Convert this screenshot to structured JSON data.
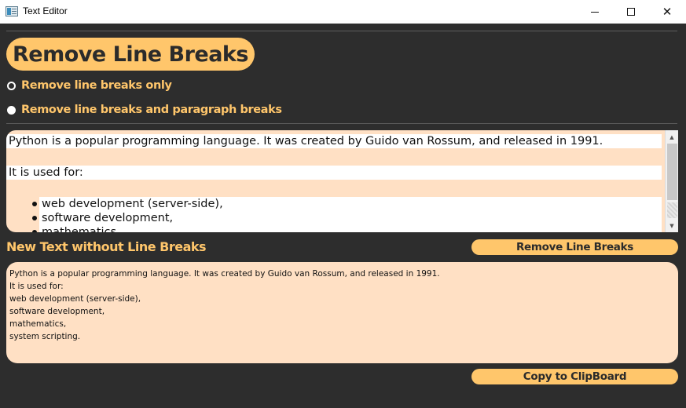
{
  "window": {
    "title": "Text Editor",
    "minimize_glyph": "",
    "maximize_glyph": "",
    "close_glyph": "✕"
  },
  "header": {
    "title": "Remove Line Breaks"
  },
  "options": {
    "radio1_label": "Remove line breaks only",
    "radio2_label": "Remove line breaks and paragraph breaks",
    "selected": "Remove line breaks and paragraph breaks"
  },
  "input_text": {
    "line1": "Python is a popular programming language. It was created by Guido van Rossum, and released in 1991.",
    "line2": "It is used for:",
    "bullets": [
      "web development (server-side),",
      "software development,",
      "mathematics,"
    ]
  },
  "output": {
    "section_label": "New Text without Line Breaks",
    "remove_button": "Remove Line Breaks",
    "copy_button": "Copy to ClipBoard",
    "lines": [
      "Python is a popular programming language. It was created by Guido van Rossum, and released in 1991.",
      "It is used for:",
      "web development (server-side),",
      "software development,",
      "mathematics,",
      "system scripting."
    ]
  },
  "colors": {
    "background": "#2d2d2d",
    "accent": "#ffc66b",
    "text_area": "#ffe0c4"
  }
}
